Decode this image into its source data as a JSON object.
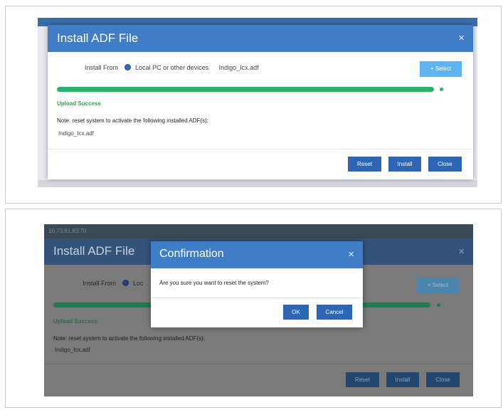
{
  "panel1": {
    "dialog": {
      "title": "Install ADF File",
      "close_symbol": "×",
      "install_from_label": "Install From",
      "source_option": "Local PC or other devices",
      "file_name": "Indigo_Icx.adf",
      "select_button": "+ Select",
      "progress_fraction": 1.0,
      "status": "Upload Success",
      "note": "Note: reset system to activate the following installed ADF(s):",
      "installed_file": "Indigo_Icx.adf",
      "buttons": {
        "reset": "Reset",
        "install": "Install",
        "close": "Close"
      }
    }
  },
  "panel2": {
    "background_window_strip": "10.73.61.83:70",
    "dialog": {
      "title": "Install ADF File",
      "close_symbol": "×",
      "install_from_label": "Install From",
      "source_option_truncated": "Loc",
      "select_button": "+ Select",
      "progress_fraction": 1.0,
      "status": "Upload Success",
      "note": "Note: reset system to activate the following installed ADF(s):",
      "installed_file": "Indigo_Icx.adf",
      "buttons": {
        "reset": "Reset",
        "install": "Install",
        "close": "Close"
      }
    },
    "confirmation": {
      "title": "Confirmation",
      "close_symbol": "×",
      "message": "Are you sure you want to reset the system?",
      "ok": "OK",
      "cancel": "Cancel"
    }
  },
  "colors": {
    "header_blue": "#3f7dc7",
    "button_blue": "#2c66b5",
    "select_blue": "#5fb3ee",
    "progress_green": "#27b36b",
    "success_green": "#3a9a5a"
  },
  "icons": [
    "close-icon",
    "radio-selected-icon"
  ]
}
